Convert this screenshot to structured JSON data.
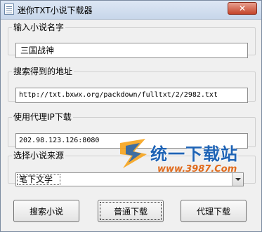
{
  "window": {
    "title": "迷你TXT小说下载器",
    "close_label": "✕"
  },
  "groups": {
    "novel_name": {
      "label": "输入小说名字",
      "value": "三国战神"
    },
    "search_url": {
      "label": "搜索得到的地址",
      "value": "http://txt.bxwx.org/packdown/fulltxt/2/2982.txt"
    },
    "proxy": {
      "label": "使用代理IP下载",
      "value": "202.98.123.126:8080"
    },
    "source": {
      "label": "选择小说来源",
      "selected": "笔下文学"
    }
  },
  "buttons": {
    "search": "搜索小说",
    "normal_download": "普通下载",
    "proxy_download": "代理下载"
  },
  "watermark": {
    "brand": "统一下载站",
    "url": "www.3987.Com",
    "color": "#1e63b5"
  }
}
